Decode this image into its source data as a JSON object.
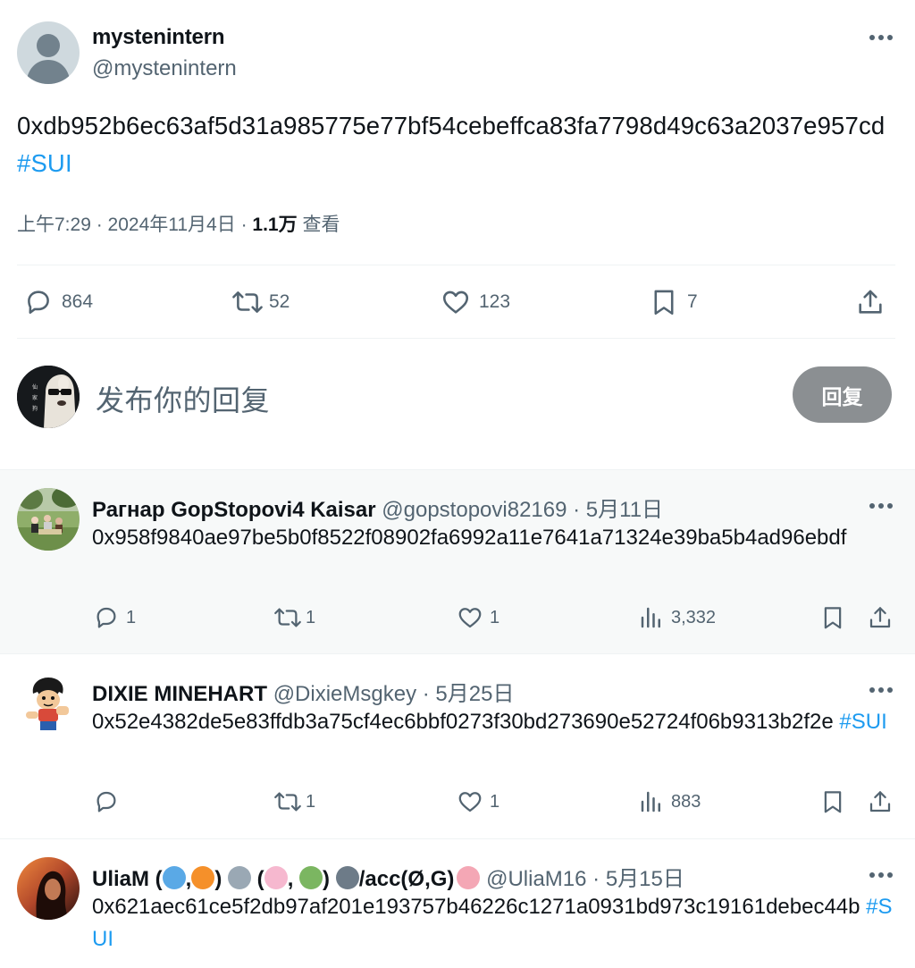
{
  "main": {
    "author_name": "mystenintern",
    "author_handle": "@mystenintern",
    "body_text": "0xdb952b6ec63af5d31a985775e77bf54cebeffca83fa7798d49c63a2037e957cd",
    "hashtag": "#SUI",
    "time": "上午7:29 · 2024年11月4日 · ",
    "views_count": "1.1万",
    "views_label": " 查看",
    "stats": {
      "replies": "864",
      "reposts": "52",
      "likes": "123",
      "bookmarks": "7"
    }
  },
  "composer": {
    "placeholder": "发布你的回复",
    "submit_label": "回复"
  },
  "replies": [
    {
      "name": "Рагнар GopStopovi4 Kaisar",
      "handle": "@gopstopovi82169",
      "date": "· 5月11日",
      "body": "0x958f9840ae97be5b0f8522f08902fa6992a11e7641a71324e39ba5b4ad96ebdf",
      "hashtag": "",
      "replies": "1",
      "reposts": "1",
      "likes": "1",
      "views": "3,332"
    },
    {
      "name": "DIXIE MINEHART",
      "handle": "@DixieMsgkey",
      "date": "· 5月25日",
      "body": "0x52e4382de5e83ffdb3a75cf4ec6bbf0273f30bd273690e52724f06b9313b2f2e",
      "hashtag": "#SUI",
      "replies": "",
      "reposts": "1",
      "likes": "1",
      "views": "883"
    },
    {
      "name_prefix": "UliaM (",
      "name_mid1": ",",
      "name_mid2": ") ",
      "name_mid3": " (",
      "name_mid4": ", ",
      "name_mid5": ") ",
      "name_suffix": "/acc(Ø,G)",
      "handle": "@UliaM16",
      "date": "· 5月15日",
      "body": "0x621aec61ce5f2db97af201e193757b46226c1271a0931bd973c19161debec44b",
      "hashtag": "#SUI"
    }
  ],
  "icons": {
    "comment": "comment-icon",
    "repost": "repost-icon",
    "like": "heart-icon",
    "bookmark": "bookmark-icon",
    "share": "share-icon",
    "views": "views-icon",
    "more": "more-icon"
  },
  "colors": {
    "link": "#1d9bf0",
    "muted": "#536471",
    "reply_button": "#8b8f92",
    "highlight_bg": "#f7f9f9"
  }
}
